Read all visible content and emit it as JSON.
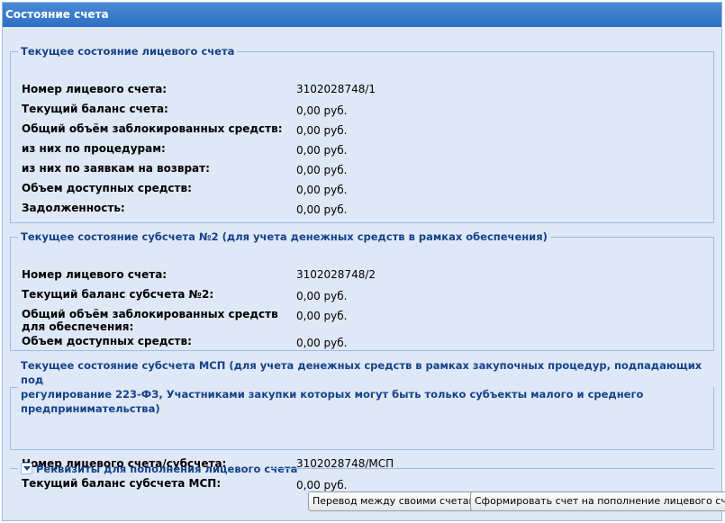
{
  "window": {
    "title": "Состояние счета"
  },
  "panel1": {
    "legend": "Текущее состояние лицевого счета",
    "rows": [
      {
        "label": "Номер лицевого счета:",
        "value": "3102028748/1"
      },
      {
        "label": "Текущий баланс счета:",
        "value": "0,00 руб."
      },
      {
        "label": "Общий объём заблокированных средств:",
        "value": "0,00 руб."
      },
      {
        "label": "из них по процедурам:",
        "value": "0,00 руб."
      },
      {
        "label": "из них по заявкам на возврат:",
        "value": "0,00 руб."
      },
      {
        "label": "Объем доступных средств:",
        "value": "0,00 руб."
      },
      {
        "label": "Задолженность:",
        "value": "0,00 руб."
      }
    ]
  },
  "panel2": {
    "legend": "Текущее состояние субсчета №2 (для учета денежных средств в рамках обеспечения)",
    "rows": [
      {
        "label": "Номер лицевого счета:",
        "value": "3102028748/2"
      },
      {
        "label": "Текущий баланс субсчета №2:",
        "value": "0,00 руб."
      },
      {
        "label": "Общий объём заблокированных средств для обеспечения:",
        "value": "0,00 руб."
      },
      {
        "label": "Объем доступных средств:",
        "value": "0,00 руб."
      }
    ]
  },
  "panel3": {
    "legend_line1": "Текущее состояние субсчета МСП (для учета денежных средств в рамках закупочных процедур, подпадающих под",
    "legend_line2": "регулирование 223-ФЗ, Участниками закупки которых могут быть только субъекты малого и среднего предпринимательства)",
    "rows": [
      {
        "label": "Номер лицевого счета/субсчета:",
        "value": "3102028748/МСП"
      },
      {
        "label": "Текущий баланс субсчета МСП:",
        "value": "0,00 руб."
      }
    ]
  },
  "requisites": {
    "title": "Реквизиты для пополнения лицевого счета",
    "expanded": false
  },
  "buttons": {
    "transfer": "Перевод между своими счетами",
    "invoice": "Сформировать счет на пополнение лицевого счета"
  }
}
